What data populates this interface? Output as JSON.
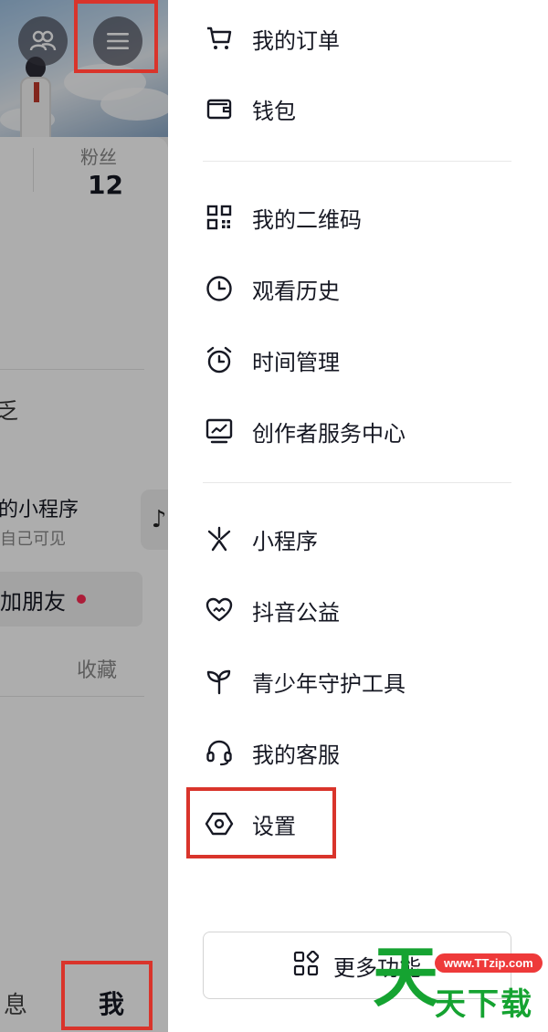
{
  "background": {
    "fans_label": "粉丝",
    "fans_count": "12",
    "edit_fragment": "乏",
    "mini_program_title": "我的小程序",
    "mini_program_sub": "仅自己可见",
    "add_friend": "加朋友",
    "collect": "收藏",
    "tab_message": "息",
    "tab_me": "我",
    "music_icon": "♪"
  },
  "menu": {
    "group1": [
      {
        "label": "我的订单",
        "icon": "cart-icon"
      },
      {
        "label": "钱包",
        "icon": "wallet-icon"
      }
    ],
    "group2": [
      {
        "label": "我的二维码",
        "icon": "qrcode-icon"
      },
      {
        "label": "观看历史",
        "icon": "clock-icon"
      },
      {
        "label": "时间管理",
        "icon": "alarm-icon"
      },
      {
        "label": "创作者服务中心",
        "icon": "chart-icon"
      }
    ],
    "group3": [
      {
        "label": "小程序",
        "icon": "mini-program-icon"
      },
      {
        "label": "抖音公益",
        "icon": "charity-heart-icon"
      },
      {
        "label": "青少年守护工具",
        "icon": "sprout-icon"
      },
      {
        "label": "我的客服",
        "icon": "headset-icon"
      },
      {
        "label": "设置",
        "icon": "settings-hexagon-icon"
      }
    ],
    "more_label": "更多功能"
  },
  "watermark": {
    "url": "www.TTzip.com",
    "big": "天",
    "small": "天下载"
  },
  "colors": {
    "highlight": "#d9342b",
    "accent_dot": "#fe2c55",
    "watermark_green": "#15a331"
  }
}
